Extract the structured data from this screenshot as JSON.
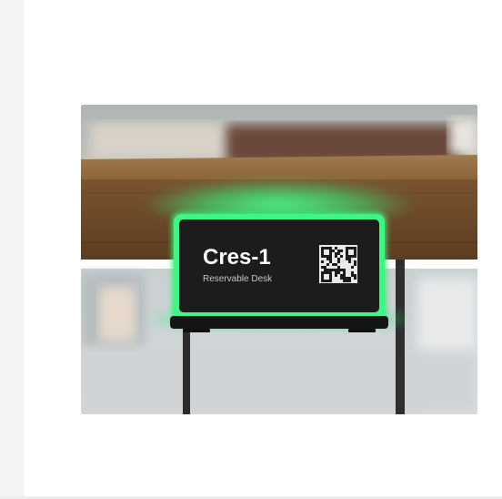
{
  "photo": {
    "alt": "Desk booking display mounted under a wooden desk",
    "display_title": "Cres-1",
    "display_subtitle": "Reservable Desk",
    "qr_icon": "qr-code-icon",
    "glow_color": "#35f07a",
    "wood_color": "#7a5430"
  }
}
